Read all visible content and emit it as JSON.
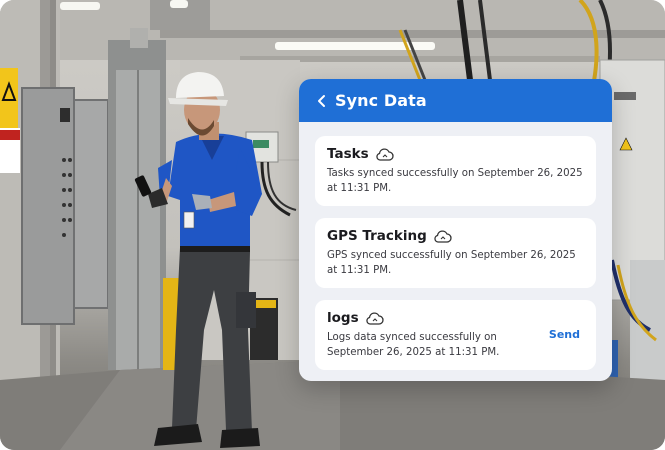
{
  "header": {
    "title": "Sync Data",
    "back_icon": "chevron-left-icon",
    "color": "#1f6fd6"
  },
  "items": [
    {
      "title": "Tasks",
      "icon": "cloud-sync-icon",
      "description": "Tasks synced successfully on September 26, 2025 at 11:31 PM."
    },
    {
      "title": "GPS Tracking",
      "icon": "cloud-sync-icon",
      "description": "GPS synced successfully on September 26, 2025 at 11:31 PM."
    },
    {
      "title": "logs",
      "icon": "cloud-sync-icon",
      "description": "Logs data synced successfully on September 26, 2025 at 11:31 PM.",
      "action_label": "Send"
    }
  ],
  "colors": {
    "accent": "#1f6fd6",
    "card_background": "#eef0f5",
    "item_background": "#ffffff"
  }
}
